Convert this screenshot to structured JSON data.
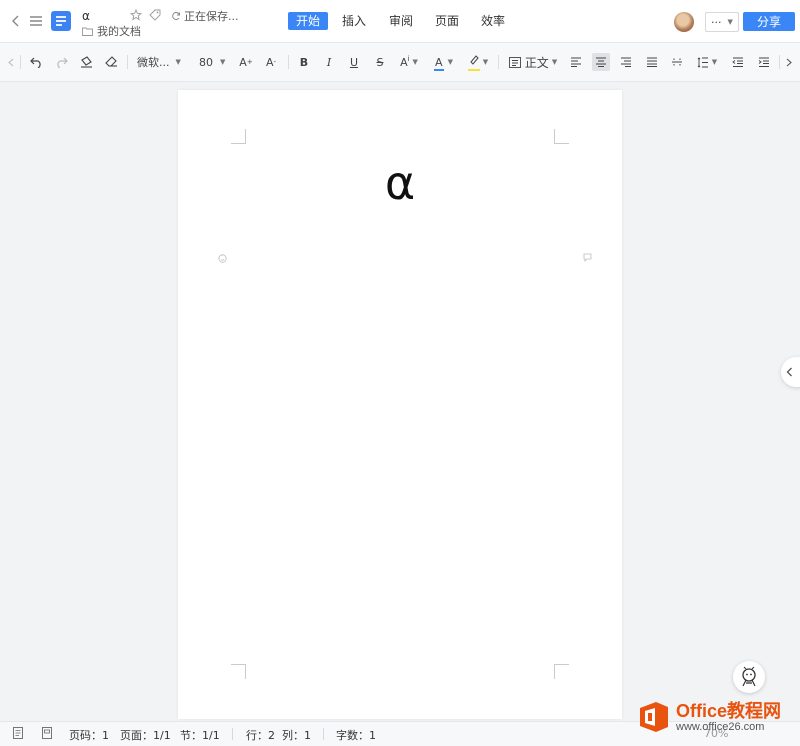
{
  "header": {
    "doc_title": "α",
    "folder": "我的文档",
    "save_status": "正在保存...",
    "tabs": [
      {
        "label": "开始",
        "active": true
      },
      {
        "label": "插入",
        "active": false
      },
      {
        "label": "审阅",
        "active": false
      },
      {
        "label": "页面",
        "active": false
      },
      {
        "label": "效率",
        "active": false
      }
    ],
    "more_label": "···",
    "share_label": "分享"
  },
  "toolbar": {
    "font_name": "微软...",
    "font_size": "80",
    "style_name": "正文",
    "grow_font": "A",
    "shrink_font": "A",
    "bold": "B",
    "italic": "I",
    "underline": "U",
    "strike": "S",
    "super": "A",
    "font_color": "A"
  },
  "document": {
    "content": "α"
  },
  "status": {
    "page_num": "页码：1",
    "page": "页面：1/1",
    "section": "节：1/1",
    "row": "行：2",
    "col": "列：1",
    "words": "字数：1",
    "zoom": "70%"
  },
  "watermark": {
    "brand": "Office教程网",
    "url": "www.office26.com"
  },
  "colors": {
    "accent": "#3a86f7",
    "font_color_bar": "#3a86f7",
    "highlight_bar": "#f5e23a",
    "watermark_orange": "#e8530f"
  }
}
